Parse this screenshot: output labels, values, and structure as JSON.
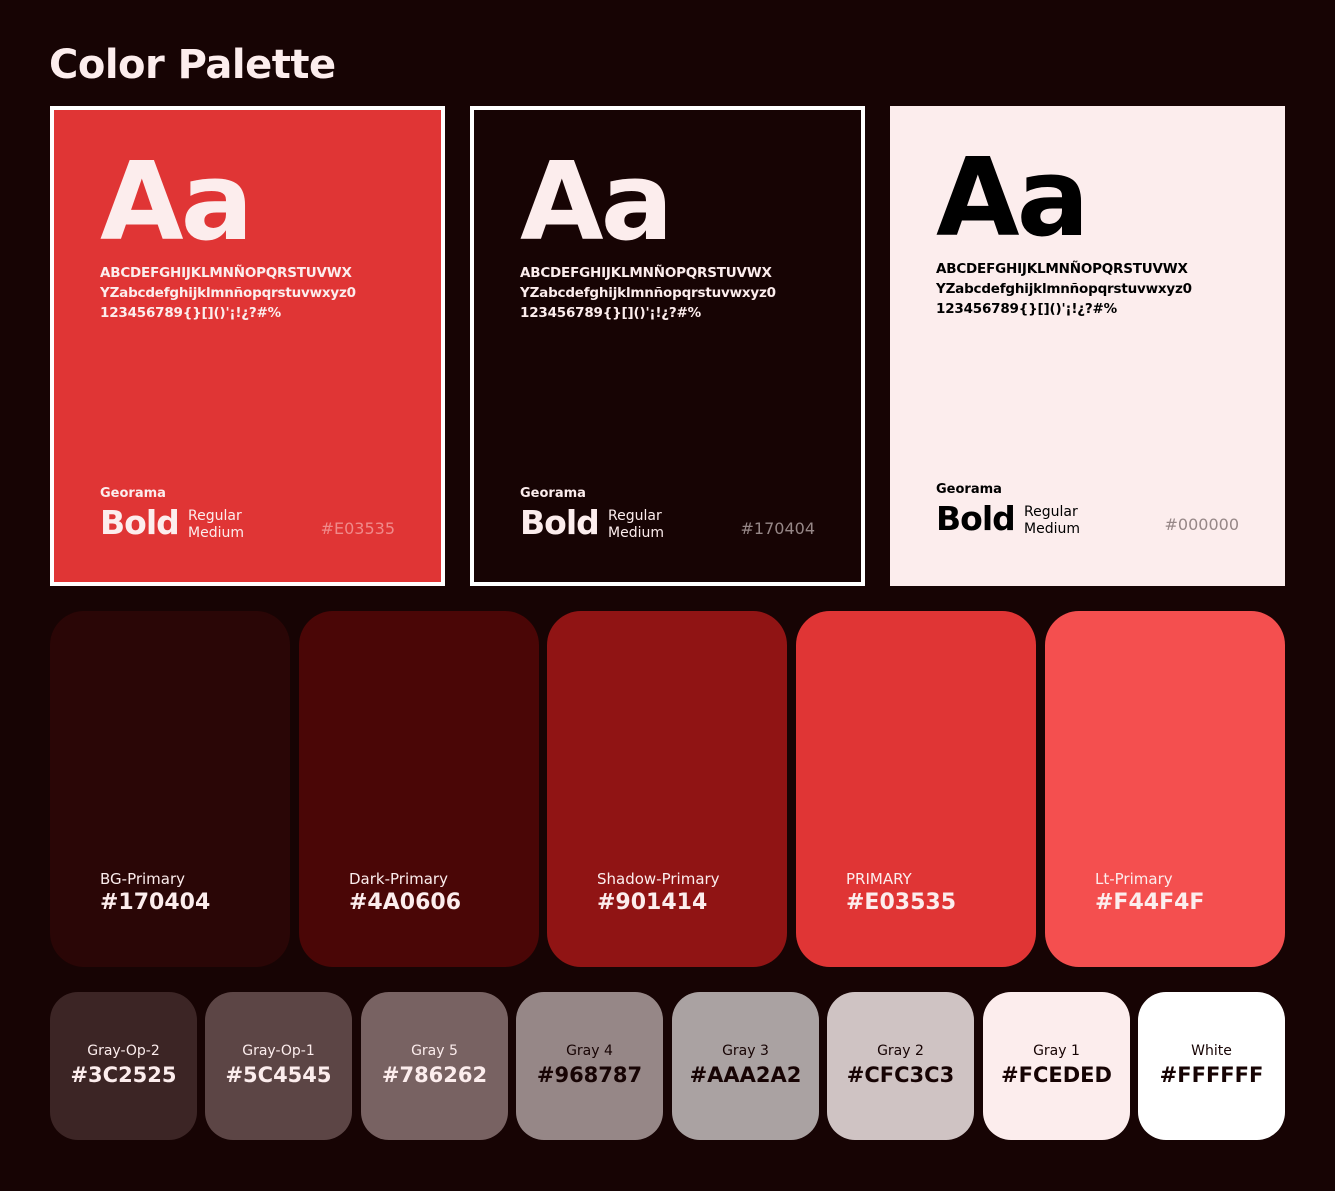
{
  "title": "Color Palette",
  "type_cards": [
    {
      "aa": "Aa",
      "glyphs": [
        "ABCDEFGHIJKLMNÑOPQRSTUVWX",
        "YZabcdefghijklmnñopqrstuvwxyz0",
        "123456789{}[]()'¡!¿?#%"
      ],
      "font_name": "Georama",
      "weight_big": "Bold",
      "weight_small": [
        "Regular",
        "Medium"
      ],
      "hex": "#E03535",
      "bg": "#E03535",
      "fg": "#FCEDED",
      "hex_color": "#F08A8A"
    },
    {
      "aa": "Aa",
      "glyphs": [
        "ABCDEFGHIJKLMNÑOPQRSTUVWX",
        "YZabcdefghijklmnñopqrstuvwxyz0",
        "123456789{}[]()'¡!¿?#%"
      ],
      "font_name": "Georama",
      "weight_big": "Bold",
      "weight_small": [
        "Regular",
        "Medium"
      ],
      "hex": "#170404",
      "bg": "#170404",
      "fg": "#FCEDED",
      "hex_color": "#968787"
    },
    {
      "aa": "Aa",
      "glyphs": [
        "ABCDEFGHIJKLMNÑOPQRSTUVWX",
        "YZabcdefghijklmnñopqrstuvwxyz0",
        "123456789{}[]()'¡!¿?#%"
      ],
      "font_name": "Georama",
      "weight_big": "Bold",
      "weight_small": [
        "Regular",
        "Medium"
      ],
      "hex": "#000000",
      "bg": "#FCEDED",
      "fg": "#000000",
      "hex_color": "#968787"
    }
  ],
  "primary_swatches": [
    {
      "name": "BG-Primary",
      "hex": "#170404",
      "color": "#2A0606"
    },
    {
      "name": "Dark-Primary",
      "hex": "#4A0606",
      "color": "#4A0606"
    },
    {
      "name": "Shadow-Primary",
      "hex": "#901414",
      "color": "#901414"
    },
    {
      "name": "PRIMARY",
      "hex": "#E03535",
      "color": "#E03535"
    },
    {
      "name": "Lt-Primary",
      "hex": "#F44F4F",
      "color": "#F44F4F"
    }
  ],
  "gray_swatches": [
    {
      "name": "Gray-Op-2",
      "hex": "#3C2525",
      "color": "#3C2525",
      "fg": "#FCEDED"
    },
    {
      "name": "Gray-Op-1",
      "hex": "#5C4545",
      "color": "#5C4545",
      "fg": "#FCEDED"
    },
    {
      "name": "Gray 5",
      "hex": "#786262",
      "color": "#786262",
      "fg": "#FCEDED"
    },
    {
      "name": "Gray 4",
      "hex": "#968787",
      "color": "#968787",
      "fg": "#170404"
    },
    {
      "name": "Gray 3",
      "hex": "#AAA2A2",
      "color": "#AAA2A2",
      "fg": "#170404"
    },
    {
      "name": "Gray 2",
      "hex": "#CFC3C3",
      "color": "#CFC3C3",
      "fg": "#170404"
    },
    {
      "name": "Gray 1",
      "hex": "#FCEDED",
      "color": "#FCEDED",
      "fg": "#170404"
    },
    {
      "name": "White",
      "hex": "#FFFFFF",
      "color": "#FFFFFF",
      "fg": "#170404"
    }
  ]
}
